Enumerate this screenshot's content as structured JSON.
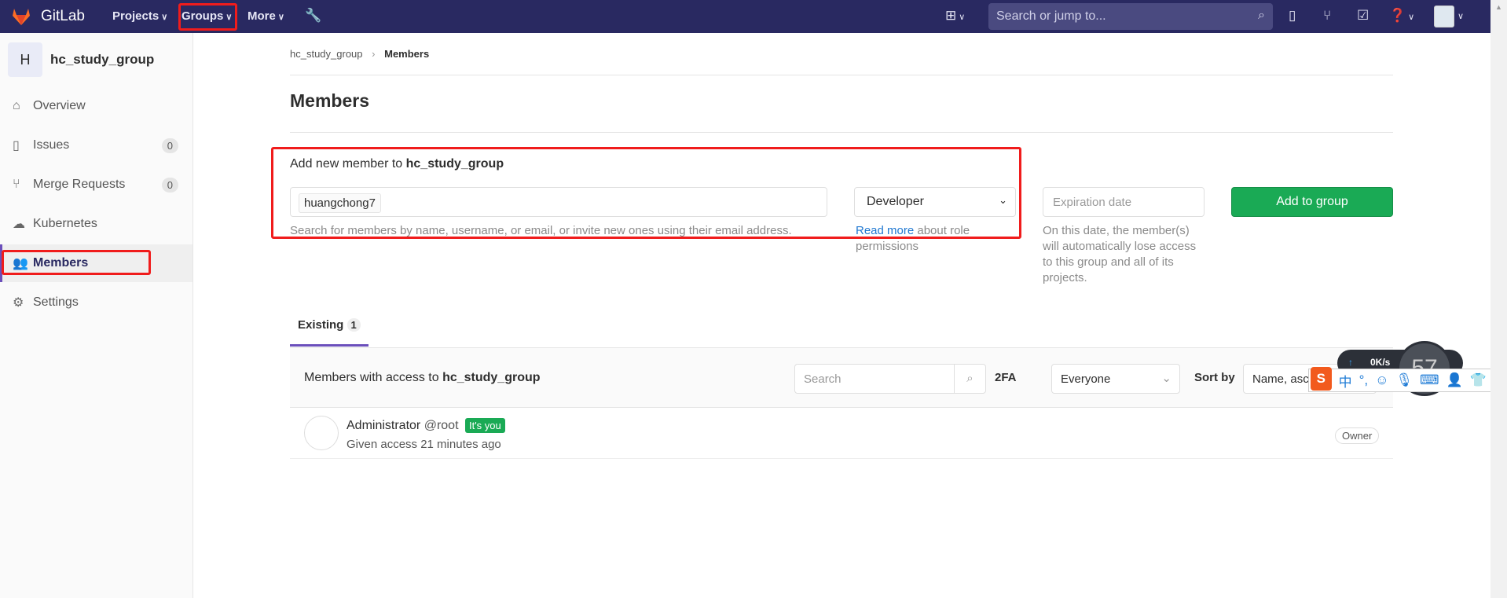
{
  "navbar": {
    "brand": "GitLab",
    "items": [
      {
        "label": "Projects"
      },
      {
        "label": "Groups"
      },
      {
        "label": "More"
      }
    ],
    "search_placeholder": "Search or jump to...",
    "icons": [
      "plus-square-icon",
      "issues-icon",
      "merge-request-icon",
      "todo-icon",
      "help-icon",
      "avatar"
    ]
  },
  "sidebar": {
    "avatar_letter": "H",
    "group_name": "hc_study_group",
    "items": [
      {
        "label": "Overview",
        "icon": "home-icon"
      },
      {
        "label": "Issues",
        "icon": "issues-icon",
        "count": "0"
      },
      {
        "label": "Merge Requests",
        "icon": "merge-request-icon",
        "count": "0"
      },
      {
        "label": "Kubernetes",
        "icon": "cloud-gear-icon"
      },
      {
        "label": "Members",
        "icon": "users-icon",
        "active": true
      },
      {
        "label": "Settings",
        "icon": "gear-icon"
      }
    ]
  },
  "breadcrumb": {
    "group": "hc_study_group",
    "current": "Members"
  },
  "page_title": "Members",
  "add_member": {
    "label_prefix": "Add new member to ",
    "group": "hc_study_group",
    "token": "huangchong7",
    "help": "Search for members by name, username, or email, or invite new ones using their email address.",
    "role": "Developer",
    "read_more": "Read more",
    "role_help": " about role permissions",
    "expiration_placeholder": "Expiration date",
    "expiration_help": "On this date, the member(s) will automatically lose access to this group and all of its projects.",
    "button": "Add to group"
  },
  "tabs": [
    {
      "label": "Existing",
      "count": "1"
    }
  ],
  "filter": {
    "prefix": "Members with access to ",
    "group": "hc_study_group",
    "search_placeholder": "Search",
    "twofa_label": "2FA",
    "twofa_value": "Everyone",
    "sort_label": "Sort by",
    "sort_value": "Name, asc"
  },
  "members": [
    {
      "name": "Administrator",
      "username": "@root",
      "badge": "It's you",
      "given": "Given access 21 minutes ago",
      "role": "Owner"
    }
  ],
  "overlay": {
    "speed": "0K/s",
    "number": "57",
    "ime_icons": [
      "sogou-logo",
      "chinese-mode-icon",
      "punctuation-icon",
      "emoji-icon",
      "microphone-icon",
      "keyboard-icon",
      "user-icon",
      "skin-icon",
      "grid-icon"
    ],
    "ime_cn": "中",
    "ime_punct": "°,"
  },
  "colors": {
    "navbar": "#292961",
    "accent": "#6b4fbb",
    "primary": "#1aaa55",
    "highlight": "#f01c1c"
  }
}
